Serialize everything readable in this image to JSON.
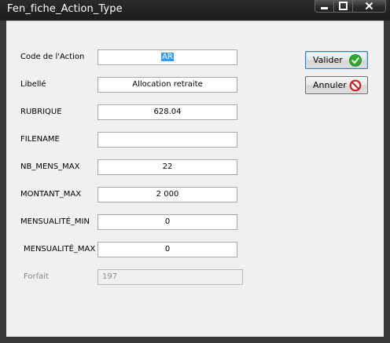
{
  "window": {
    "title": "Fen_fiche_Action_Type"
  },
  "form": {
    "fields": [
      {
        "label": "Code de l'Action",
        "value": "AR"
      },
      {
        "label": "Libellé",
        "value": "Allocation retraite"
      },
      {
        "label": "RUBRIQUE",
        "value": "628.04"
      },
      {
        "label": "FILENAME",
        "value": ""
      },
      {
        "label": "NB_MENS_MAX",
        "value": "22"
      },
      {
        "label": "MONTANT_MAX",
        "value": "2 000"
      },
      {
        "label": "MENSUALITÉ_MIN",
        "value": "0"
      },
      {
        "label": "MENSUALITÉ_MAX",
        "value": "0"
      },
      {
        "label": "Forfait",
        "value": "197",
        "disabled": true
      }
    ]
  },
  "buttons": {
    "validate_label": "Valider",
    "validate_icon": "check-icon",
    "cancel_label": "Annuler",
    "cancel_icon": "no-entry-icon"
  },
  "colors": {
    "validate_icon": "#2fa82f",
    "cancel_icon": "#d0202a",
    "selection": "#3399ff"
  }
}
